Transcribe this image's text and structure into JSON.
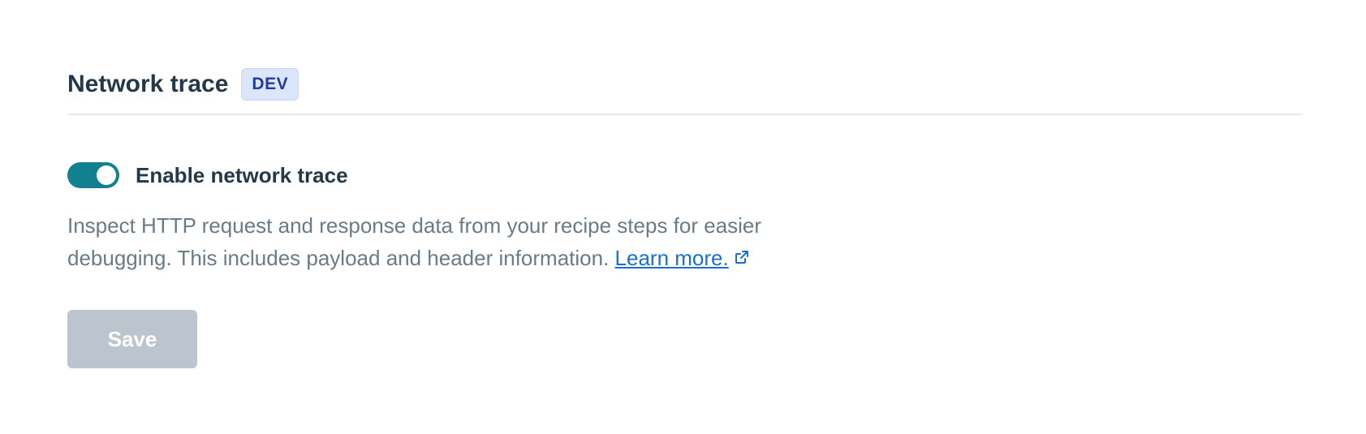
{
  "section": {
    "title": "Network trace",
    "badge": "DEV"
  },
  "toggle": {
    "label": "Enable network trace",
    "enabled": true,
    "color": "#13808f"
  },
  "description": {
    "text": "Inspect HTTP request and response data from your recipe steps for easier debugging. This includes payload and header information. ",
    "link_label": "Learn more.",
    "link_icon": "external-link-icon"
  },
  "actions": {
    "save_label": "Save",
    "save_disabled": true
  }
}
